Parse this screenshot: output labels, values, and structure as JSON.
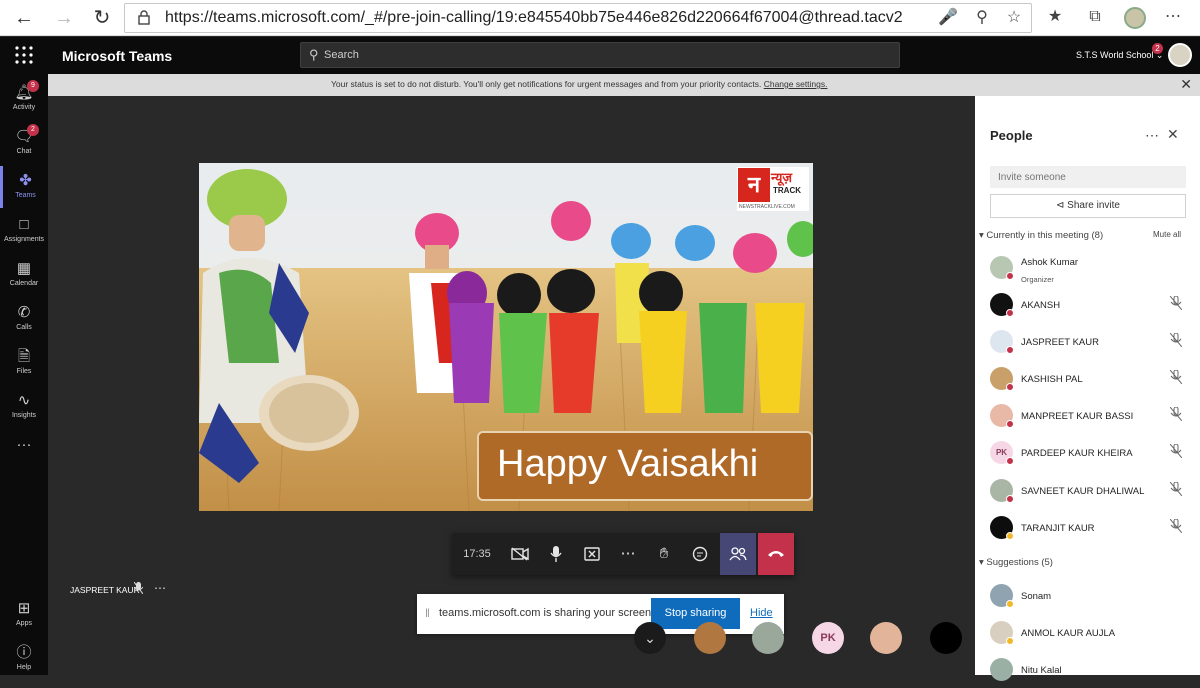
{
  "browser": {
    "url": "https://teams.microsoft.com/_#/pre-join-calling/19:e845540bb75e446e826d220664f67004@thread.tacv2"
  },
  "teams": {
    "app_name": "Microsoft Teams",
    "search_placeholder": "Search",
    "org_name": "S.T.S World School",
    "org_badge": "2"
  },
  "rail": {
    "items": [
      {
        "label": "Activity",
        "icon": "bell-icon",
        "badge": "9"
      },
      {
        "label": "Chat",
        "icon": "chat-icon",
        "badge": "2"
      },
      {
        "label": "Teams",
        "icon": "teams-icon",
        "badge": ""
      },
      {
        "label": "Assignments",
        "icon": "assignments-icon",
        "badge": ""
      },
      {
        "label": "Calendar",
        "icon": "calendar-icon",
        "badge": ""
      },
      {
        "label": "Calls",
        "icon": "phone-icon",
        "badge": ""
      },
      {
        "label": "Files",
        "icon": "file-icon",
        "badge": ""
      },
      {
        "label": "Insights",
        "icon": "insights-icon",
        "badge": ""
      }
    ],
    "more": "···",
    "bottom": [
      {
        "label": "Apps",
        "icon": "apps-icon"
      },
      {
        "label": "Help",
        "icon": "help-icon"
      }
    ]
  },
  "banner": {
    "text": "Your status is set to do not disturb. You'll only get notifications for urgent messages and from your priority contacts.",
    "link": "Change settings."
  },
  "shared_content": {
    "caption": "Happy Vaisakhi",
    "logo_brand": "न्यूज़",
    "logo_track": "TRACK",
    "logo_site": "NEWSTRACKLIVE.COM"
  },
  "call": {
    "timer": "17:35",
    "self_name": "JASPREET KAUR"
  },
  "share_notice": {
    "text": "teams.microsoft.com is sharing your screen.",
    "stop": "Stop sharing",
    "hide": "Hide"
  },
  "stage_avatars": {
    "pk_initials": "PK"
  },
  "people": {
    "title": "People",
    "invite_placeholder": "Invite someone",
    "share_invite": "Share invite",
    "current_header": "Currently in this meeting (8)",
    "mute_all": "Mute all",
    "participants": [
      {
        "name": "Ashok Kumar",
        "role": "Organizer"
      },
      {
        "name": "AKANSH"
      },
      {
        "name": "JASPREET KAUR"
      },
      {
        "name": "KASHISH PAL"
      },
      {
        "name": "MANPREET KAUR BASSI"
      },
      {
        "name": "PARDEEP KAUR KHEIRA",
        "initials": "PK"
      },
      {
        "name": "SAVNEET KAUR DHALIWAL"
      },
      {
        "name": "TARANJIT KAUR"
      }
    ],
    "suggestions_header": "Suggestions (5)",
    "suggestions": [
      {
        "name": "Sonam"
      },
      {
        "name": "ANMOL KAUR AUJLA"
      },
      {
        "name": "Nitu Kalal"
      }
    ]
  },
  "colors": {
    "accent": "#6264a7",
    "leave": "#c4314b",
    "stop_sharing": "#0f6cbd",
    "dnd": "#c4314b"
  }
}
